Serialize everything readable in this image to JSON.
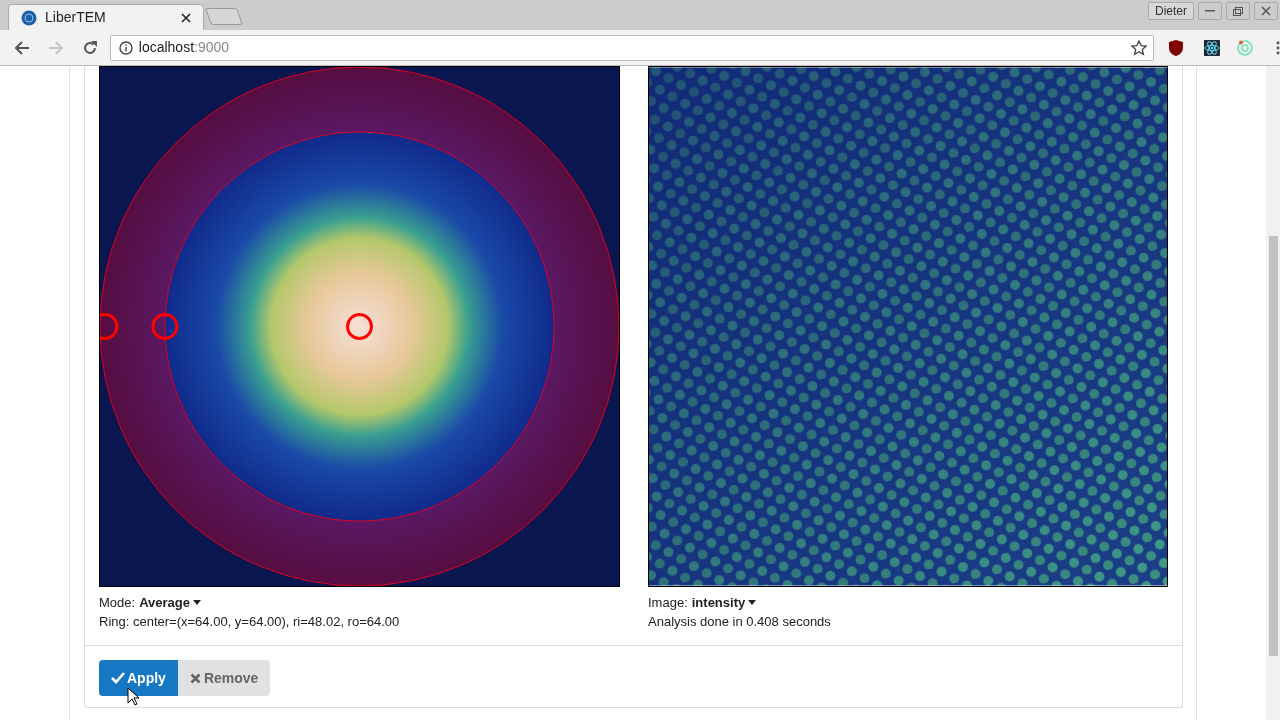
{
  "browser": {
    "tabs": [
      {
        "title": "LiberTEM",
        "selected": true
      }
    ],
    "address": {
      "host": "localhost",
      "port": ":9000"
    },
    "profile": "Dieter"
  },
  "analysis": {
    "left": {
      "mode_label": "Mode:",
      "mode_value": "Average",
      "info": "Ring: center=(x=64.00, y=64.00), ri=48.02, ro=64.00"
    },
    "right": {
      "image_label": "Image:",
      "image_value": "intensity",
      "info": "Analysis done in 0.408 seconds"
    },
    "buttons": [
      {
        "label": "Apply",
        "kind": "primary"
      },
      {
        "label": "Remove",
        "kind": "secondary"
      }
    ]
  }
}
